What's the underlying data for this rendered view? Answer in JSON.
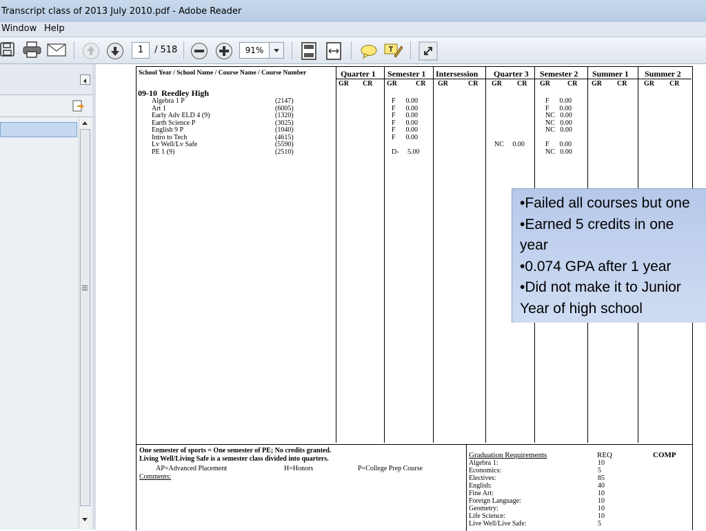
{
  "window": {
    "title": "Transcript class of 2013 July 2010.pdf - Adobe Reader"
  },
  "menu": {
    "items": [
      "Window",
      "Help"
    ]
  },
  "toolbar": {
    "page_current": "1",
    "page_total": "/ 518",
    "zoom": "91%"
  },
  "transcript": {
    "header_first_col": "School Year / School Name / Course Name / Course Number",
    "terms": [
      "Quarter 1",
      "Semester 1",
      "Intersession",
      "Quarter 3",
      "Semester 2",
      "Summer 1",
      "Summer 2"
    ],
    "gr_label": "GR",
    "cr_label": "CR",
    "school_line": "09-10  Reedley High",
    "courses": [
      {
        "name": "Algebra 1 P",
        "num": "(2147)",
        "s1": "F      0.00",
        "q3": "",
        "s2": "F      0.00"
      },
      {
        "name": "Art 1",
        "num": "(6005)",
        "s1": "F      0.00",
        "q3": "",
        "s2": "F      0.00"
      },
      {
        "name": "Early Adv ELD 4 (9)",
        "num": "(1320)",
        "s1": "F      0.00",
        "q3": "",
        "s2": "NC   0.00"
      },
      {
        "name": "Earth Science P",
        "num": "(3025)",
        "s1": "F      0.00",
        "q3": "",
        "s2": "NC   0.00"
      },
      {
        "name": "English 9 P",
        "num": "(1040)",
        "s1": "F      0.00",
        "q3": "",
        "s2": "NC   0.00"
      },
      {
        "name": "Intro to Tech",
        "num": "(4615)",
        "s1": "F      0.00",
        "q3": "",
        "s2": ""
      },
      {
        "name": "Lv Well/Lv Safe",
        "num": "(5590)",
        "s1": "",
        "q3": "NC     0.00",
        "s2": "F      0.00"
      },
      {
        "name": "PE 1 (9)",
        "num": "(2510)",
        "s1": "D-     5.00",
        "q3": "",
        "s2": "NC   0.00"
      }
    ],
    "footer": {
      "line1": "One semester of sports = One semester of PE; No credits granted.",
      "line2": "Living Well/Living Safe is a semester class divided into quarters.",
      "ap": "AP=Advanced Placement",
      "honors": "H=Honors",
      "cp": "P=College Prep Course",
      "comments": "Comments:"
    },
    "graduation": {
      "title": "Graduation Requirements",
      "req_label": "REQ",
      "comp_label": "COMP",
      "rows": [
        {
          "subject": "Algebra 1:",
          "req": "10"
        },
        {
          "subject": "Economics:",
          "req": "5"
        },
        {
          "subject": "Electives:",
          "req": "85"
        },
        {
          "subject": "English:",
          "req": "40"
        },
        {
          "subject": "Fine Art:",
          "req": "10"
        },
        {
          "subject": "Foreign Language:",
          "req": "10"
        },
        {
          "subject": "Geometry:",
          "req": "10"
        },
        {
          "subject": "Life Science:",
          "req": "10"
        },
        {
          "subject": "Live Well/Live Safe:",
          "req": "5"
        }
      ]
    }
  },
  "callout": {
    "lines": [
      "•Failed all courses but one",
      "•Earned 5 credits in one",
      "year",
      "•0.074 GPA after 1 year",
      "•Did not make it to Junior",
      "Year of high school"
    ]
  }
}
